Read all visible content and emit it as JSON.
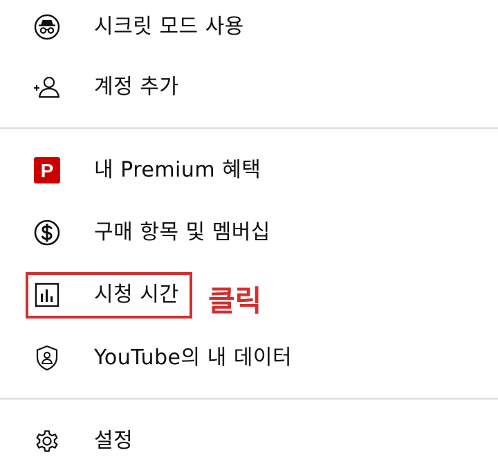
{
  "menu": {
    "items": [
      {
        "id": "incognito",
        "label": "시크릿 모드 사용",
        "icon": "incognito-icon"
      },
      {
        "id": "add-account",
        "label": "계정 추가",
        "icon": "add-person-icon"
      },
      {
        "id": "premium",
        "label": "내 Premium 혜택",
        "icon": "premium-badge-icon",
        "icon_text": "P"
      },
      {
        "id": "purchases",
        "label": "구매 항목 및 멤버십",
        "icon": "dollar-circle-icon"
      },
      {
        "id": "watch-time",
        "label": "시청 시간",
        "icon": "bar-chart-icon"
      },
      {
        "id": "your-data",
        "label": "YouTube의 내 데이터",
        "icon": "shield-person-icon"
      },
      {
        "id": "settings",
        "label": "설정",
        "icon": "gear-icon"
      }
    ]
  },
  "annotation": {
    "text": "클릭",
    "color": "#d32f2f"
  },
  "colors": {
    "premium_red": "#cc0000",
    "text": "#0f0f0f",
    "divider": "#dcdcdc"
  }
}
